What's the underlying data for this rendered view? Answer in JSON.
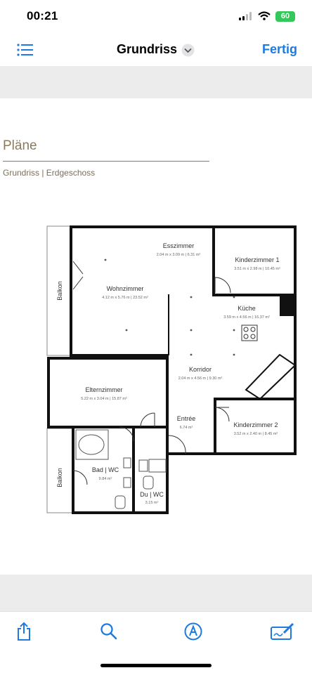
{
  "status_bar": {
    "time": "00:21",
    "battery": "60"
  },
  "nav": {
    "title": "Grundriss",
    "done_label": "Fertig"
  },
  "document": {
    "heading": "Pläne",
    "subheading": "Grundriss | Erdgeschoss",
    "rooms": [
      {
        "name": "Esszimmer",
        "dims": "2.04 m x 3.09 m | 6.31 m²"
      },
      {
        "name": "Kinderzimmer 1",
        "dims": "3.51 m x 2.98 m | 10.45 m²"
      },
      {
        "name": "Wohnzimmer",
        "dims": "4.12 m x 5.76 m | 23.52 m²"
      },
      {
        "name": "Küche",
        "dims": "3.59 m x 4.56 m | 16.37 m²"
      },
      {
        "name": "Korridor",
        "dims": "2.04 m x 4.56 m | 9.30 m²"
      },
      {
        "name": "Elternzimmer",
        "dims": "5.22 m x 3.04 m | 15.87 m²"
      },
      {
        "name": "Entrée",
        "dims": "6.74 m²"
      },
      {
        "name": "Kinderzimmer 2",
        "dims": "3.52 m x 2.40 m | 8.45 m²"
      },
      {
        "name": "Bad | WC",
        "dims": "9.84 m²"
      },
      {
        "name": "Du | WC",
        "dims": "3.15 m²"
      }
    ],
    "balconies": [
      "Balkon",
      "Balkon"
    ]
  },
  "colors": {
    "accent": "#1f7ae0",
    "heading": "#8c7a5b",
    "battery": "#34c759"
  },
  "toolbar": {
    "items": [
      {
        "icon": "share-icon"
      },
      {
        "icon": "search-icon"
      },
      {
        "icon": "markup-icon"
      },
      {
        "icon": "signature-icon"
      }
    ]
  }
}
